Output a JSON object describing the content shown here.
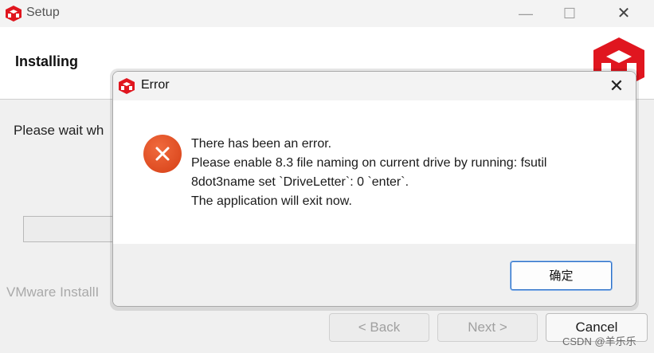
{
  "setup_window": {
    "title": "Setup",
    "window_controls": {
      "minimize": "—",
      "maximize": "☐",
      "close": "✕"
    },
    "header_title": "Installing",
    "body_text": "Please wait wh",
    "brand_text": "VMware InstallI",
    "buttons": {
      "back": "< Back",
      "next": "Next >",
      "cancel": "Cancel"
    }
  },
  "error_dialog": {
    "title": "Error",
    "close": "✕",
    "message_lines": [
      "There has been an error.",
      "Please enable 8.3 file naming on current drive by running: fsutil",
      "8dot3name set `DriveLetter`: 0 `enter`.",
      "The application will exit now."
    ],
    "ok_label": "确定"
  },
  "watermark": "CSDN @羊乐乐",
  "colors": {
    "brand_red": "#e0161f",
    "error_orange": "#e04a1c",
    "focus_blue": "#2b6fc6"
  },
  "icons": {
    "app": "vmware-cube-icon",
    "error": "error-x-icon"
  }
}
